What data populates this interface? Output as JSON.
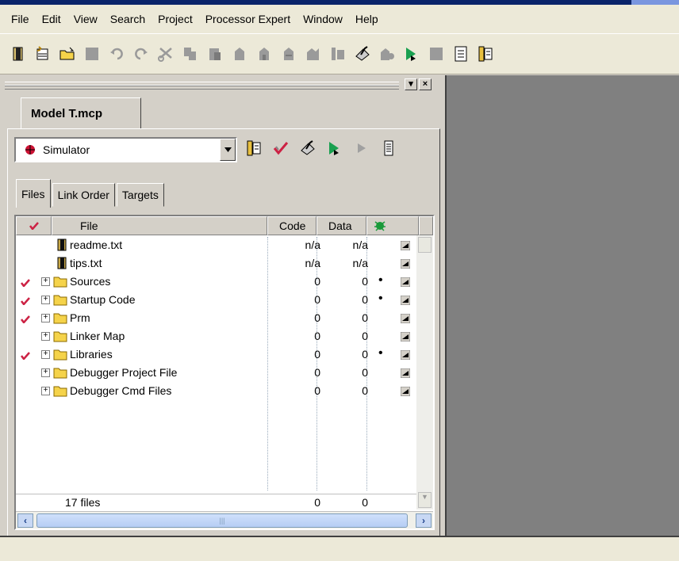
{
  "menubar": {
    "items": [
      "File",
      "Edit",
      "View",
      "Search",
      "Project",
      "Processor Expert",
      "Window",
      "Help"
    ]
  },
  "toolbar": {
    "buttons": [
      "new-file-icon",
      "new-project-icon",
      "open-folder-icon",
      "save-icon",
      "undo-icon",
      "redo-icon",
      "cut-icon",
      "copy-icon",
      "paste-icon",
      "find-icon",
      "find-next-icon",
      "replace-icon",
      "compare-icon",
      "make-icon",
      "debug-icon",
      "run-icon",
      "stop-icon",
      "settings-icon",
      "target-settings-icon"
    ]
  },
  "project": {
    "tab_title": "Model T.mcp",
    "target": "Simulator",
    "subtabs": [
      "Files",
      "Link Order",
      "Targets"
    ],
    "columns": {
      "file": "File",
      "code": "Code",
      "data": "Data"
    },
    "files": [
      {
        "name": "readme.txt",
        "code": "n/a",
        "data": "n/a",
        "checked": false,
        "folder": false,
        "dot": ""
      },
      {
        "name": "tips.txt",
        "code": "n/a",
        "data": "n/a",
        "checked": false,
        "folder": false,
        "dot": ""
      },
      {
        "name": "Sources",
        "code": "0",
        "data": "0",
        "checked": true,
        "folder": true,
        "dot": "•"
      },
      {
        "name": "Startup Code",
        "code": "0",
        "data": "0",
        "checked": true,
        "folder": true,
        "dot": "•"
      },
      {
        "name": "Prm",
        "code": "0",
        "data": "0",
        "checked": true,
        "folder": true,
        "dot": ""
      },
      {
        "name": "Linker Map",
        "code": "0",
        "data": "0",
        "checked": false,
        "folder": true,
        "dot": ""
      },
      {
        "name": "Libraries",
        "code": "0",
        "data": "0",
        "checked": true,
        "folder": true,
        "dot": "•"
      },
      {
        "name": "Debugger Project File",
        "code": "0",
        "data": "0",
        "checked": false,
        "folder": true,
        "dot": ""
      },
      {
        "name": "Debugger Cmd Files",
        "code": "0",
        "data": "0",
        "checked": false,
        "folder": true,
        "dot": ""
      }
    ],
    "footer": {
      "count": "17 files",
      "code": "0",
      "data": "0"
    }
  },
  "colors": {
    "check": "#cc2244",
    "folder": "#f5d34a",
    "workspace": "#808080"
  }
}
